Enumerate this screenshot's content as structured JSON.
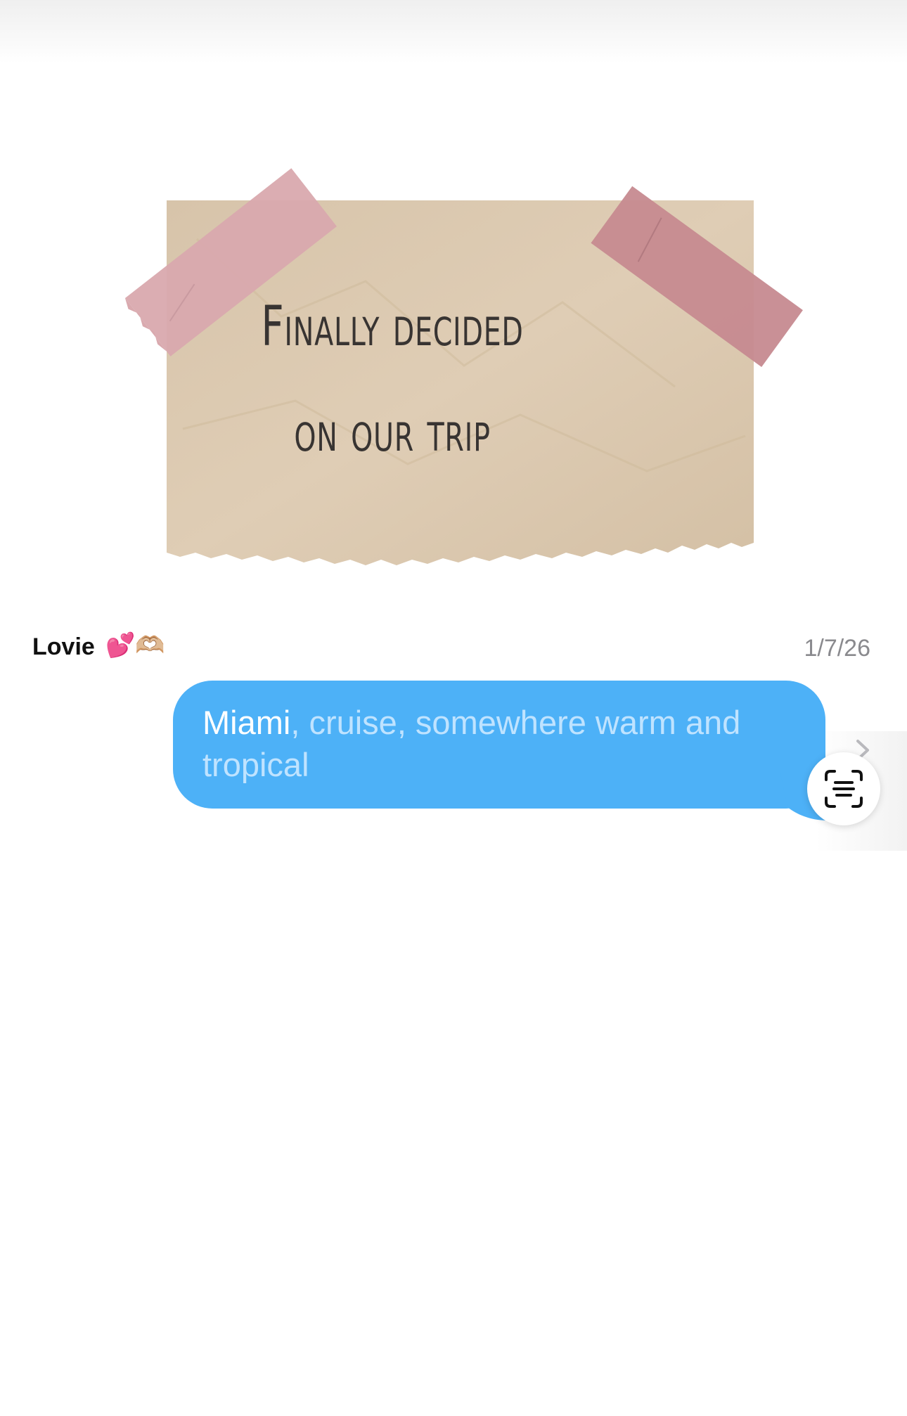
{
  "note": {
    "title": "Finally decided\non our trip"
  },
  "sender": {
    "name": "Lovie",
    "emojis": "💕🫶🏼"
  },
  "timestamp": "1/7/26",
  "message": {
    "first_word": "Miami",
    "rest": ", cruise, somewhere warm and tropical"
  },
  "icons": {
    "scan": "live-text-scan-icon",
    "chevron": "chevron-right-icon"
  },
  "colors": {
    "bubble": "#4db1f7",
    "paper": "#dbc9b0",
    "tape_left": "#d9a9ae",
    "tape_right": "#c58a8f"
  }
}
